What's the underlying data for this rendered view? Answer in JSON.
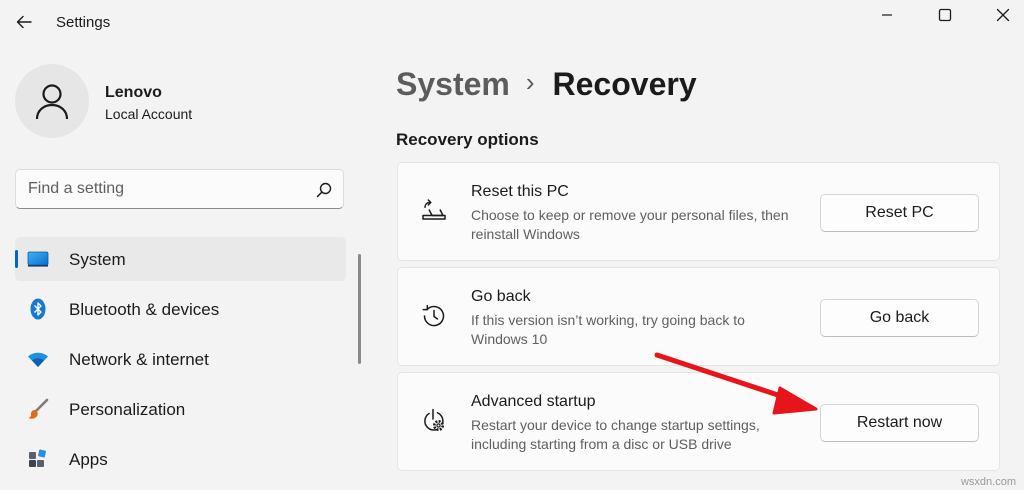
{
  "window": {
    "app_title": "Settings"
  },
  "user": {
    "name": "Lenovo",
    "account_type": "Local Account"
  },
  "search": {
    "placeholder": "Find a setting"
  },
  "sidebar": {
    "items": [
      {
        "label": "System",
        "icon": "monitor-icon",
        "active": true
      },
      {
        "label": "Bluetooth & devices",
        "icon": "bluetooth-icon",
        "active": false
      },
      {
        "label": "Network & internet",
        "icon": "wifi-icon",
        "active": false
      },
      {
        "label": "Personalization",
        "icon": "paintbrush-icon",
        "active": false
      },
      {
        "label": "Apps",
        "icon": "apps-icon",
        "active": false
      }
    ]
  },
  "breadcrumb": {
    "parent": "System",
    "separator": "›",
    "current": "Recovery"
  },
  "section": {
    "title": "Recovery options"
  },
  "cards": [
    {
      "title": "Reset this PC",
      "description": "Choose to keep or remove your personal files, then reinstall Windows",
      "button": "Reset PC",
      "icon": "reset-pc-icon"
    },
    {
      "title": "Go back",
      "description": "If this version isn’t working, try going back to Windows 10",
      "button": "Go back",
      "icon": "history-icon"
    },
    {
      "title": "Advanced startup",
      "description": "Restart your device to change startup settings, including starting from a disc or USB drive",
      "button": "Restart now",
      "icon": "advanced-startup-icon"
    }
  ],
  "watermark": "wsxdn.com",
  "colors": {
    "accent": "#0067c0",
    "annotation_arrow": "#e8141b",
    "background": "#f3f3f3",
    "card": "#fbfbfb"
  }
}
